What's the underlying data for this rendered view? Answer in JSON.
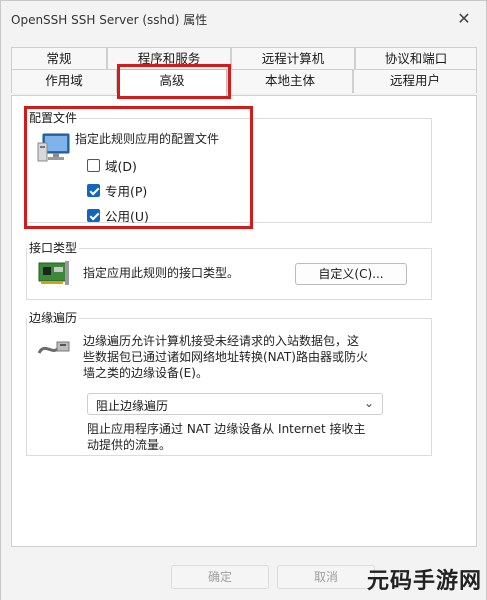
{
  "window": {
    "title": "OpenSSH SSH Server (sshd) 属性",
    "close_glyph": "✕"
  },
  "tabs": {
    "row1": [
      "常规",
      "程序和服务",
      "远程计算机",
      "协议和端口"
    ],
    "row2": [
      "作用域",
      "高级",
      "本地主体",
      "远程用户"
    ],
    "active": "高级"
  },
  "profiles": {
    "group_title": "配置文件",
    "description": "指定此规则应用的配置文件",
    "icon": "monitor-profile-icon",
    "options": [
      {
        "label": "域(D)",
        "checked": false
      },
      {
        "label": "专用(P)",
        "checked": true
      },
      {
        "label": "公用(U)",
        "checked": true
      }
    ]
  },
  "interface": {
    "group_title": "接口类型",
    "description": "指定应用此规则的接口类型。",
    "icon": "network-card-icon",
    "customize_label": "自定义(C)..."
  },
  "edge": {
    "group_title": "边缘遍历",
    "description_lines": [
      "边缘遍历允许计算机接受未经请求的入站数据包，这",
      "些数据包已通过诸如网络地址转换(NAT)路由器或防火",
      "墙之类的边缘设备(E)。"
    ],
    "icon": "cable-icon",
    "dropdown_value": "阻止边缘遍历",
    "detail_lines": [
      "阻止应用程序通过 NAT 边缘设备从 Internet 接收主",
      "动提供的流量。"
    ]
  },
  "footer": {
    "ok_label": "确定",
    "cancel_label": "取消"
  },
  "watermark": "元码手游网",
  "colors": {
    "highlight": "#d21c1c",
    "accent": "#1565c0"
  }
}
